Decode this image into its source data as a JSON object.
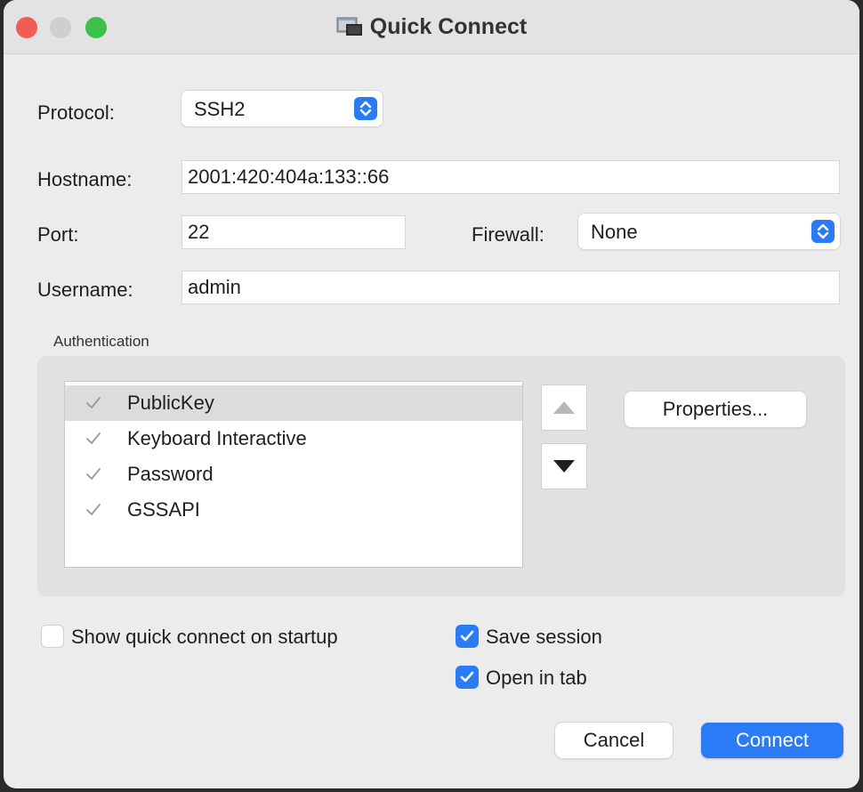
{
  "window": {
    "title": "Quick Connect"
  },
  "form": {
    "protocol_label": "Protocol:",
    "protocol_value": "SSH2",
    "hostname_label": "Hostname:",
    "hostname_value": "2001:420:404a:133::66",
    "port_label": "Port:",
    "port_value": "22",
    "firewall_label": "Firewall:",
    "firewall_value": "None",
    "username_label": "Username:",
    "username_value": "admin"
  },
  "authentication": {
    "section_label": "Authentication",
    "methods": [
      {
        "label": "PublicKey",
        "checked": true,
        "selected": true
      },
      {
        "label": "Keyboard Interactive",
        "checked": true,
        "selected": false
      },
      {
        "label": "Password",
        "checked": true,
        "selected": false
      },
      {
        "label": "GSSAPI",
        "checked": true,
        "selected": false
      }
    ],
    "properties_label": "Properties..."
  },
  "options": {
    "show_on_startup_label": "Show quick connect on startup",
    "show_on_startup_checked": false,
    "save_session_label": "Save session",
    "save_session_checked": true,
    "open_in_tab_label": "Open in tab",
    "open_in_tab_checked": true
  },
  "buttons": {
    "cancel_label": "Cancel",
    "connect_label": "Connect"
  },
  "colors": {
    "accent": "#2c7bf6",
    "close": "#ee5e55",
    "minimize_inactive": "#cfcfcf",
    "maximize": "#3bc14a"
  }
}
